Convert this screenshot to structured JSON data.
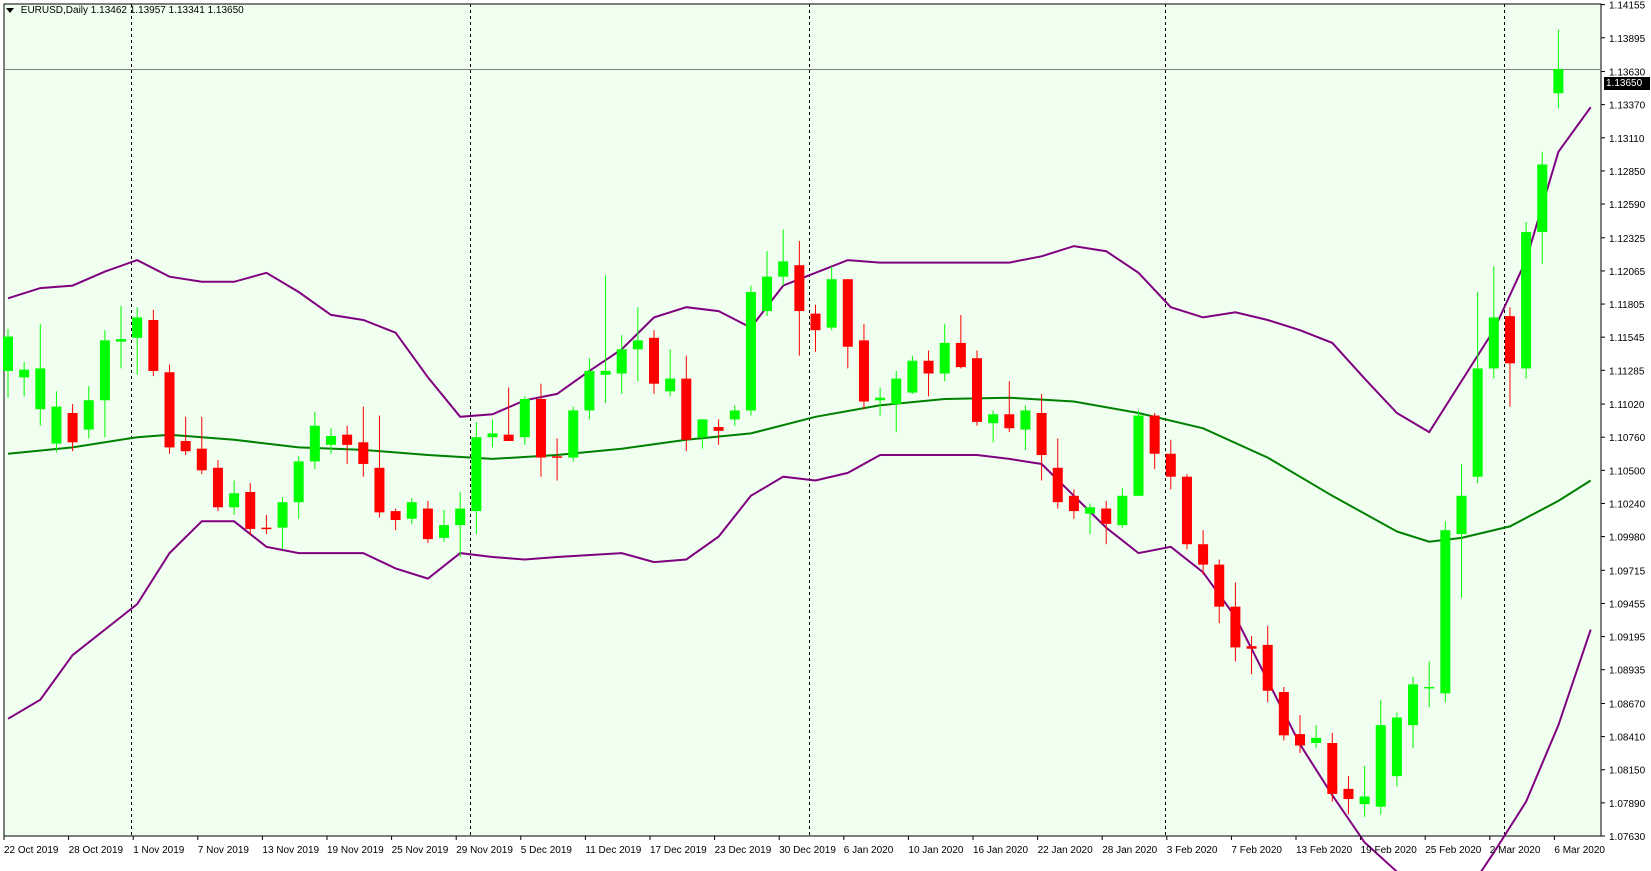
{
  "header": {
    "symbol": "EURUSD,Daily",
    "ohlc": "1.13462 1.13957 1.13341 1.13650"
  },
  "current_price": {
    "label": "1.13650",
    "value": 1.1365
  },
  "colors": {
    "background": "#f0fff0",
    "bull": "#00ff00",
    "bear": "#ff0000",
    "wick": "#00ff00",
    "middle_band": "#008000",
    "outer_band": "#800080",
    "grid": "#000000"
  },
  "chart_data": {
    "type": "candlestick",
    "ylim": [
      1.0763,
      1.1416
    ],
    "y_ticks": [
      "1.14155",
      "1.13895",
      "1.13630",
      "1.13370",
      "1.13110",
      "1.12850",
      "1.12590",
      "1.12325",
      "1.12065",
      "1.11805",
      "1.11545",
      "1.11285",
      "1.11020",
      "1.10760",
      "1.10500",
      "1.10240",
      "1.09980",
      "1.09715",
      "1.09455",
      "1.09195",
      "1.08935",
      "1.08670",
      "1.08410",
      "1.08150",
      "1.07890",
      "1.07630"
    ],
    "x_ticks": [
      {
        "label": "22 Oct 2019",
        "index": 0
      },
      {
        "label": "28 Oct 2019",
        "index": 4
      },
      {
        "label": "1 Nov 2019",
        "index": 8
      },
      {
        "label": "7 Nov 2019",
        "index": 12
      },
      {
        "label": "13 Nov 2019",
        "index": 16
      },
      {
        "label": "19 Nov 2019",
        "index": 20
      },
      {
        "label": "25 Nov 2019",
        "index": 24
      },
      {
        "label": "29 Nov 2019",
        "index": 28
      },
      {
        "label": "5 Dec 2019",
        "index": 32
      },
      {
        "label": "11 Dec 2019",
        "index": 36
      },
      {
        "label": "17 Dec 2019",
        "index": 40
      },
      {
        "label": "23 Dec 2019",
        "index": 44
      },
      {
        "label": "30 Dec 2019",
        "index": 48
      },
      {
        "label": "6 Jan 2020",
        "index": 52
      },
      {
        "label": "10 Jan 2020",
        "index": 56
      },
      {
        "label": "16 Jan 2020",
        "index": 60
      },
      {
        "label": "22 Jan 2020",
        "index": 64
      },
      {
        "label": "28 Jan 2020",
        "index": 68
      },
      {
        "label": "3 Feb 2020",
        "index": 72
      },
      {
        "label": "7 Feb 2020",
        "index": 76
      },
      {
        "label": "13 Feb 2020",
        "index": 80
      },
      {
        "label": "19 Feb 2020",
        "index": 84
      },
      {
        "label": "25 Feb 2020",
        "index": 88
      },
      {
        "label": "2 Mar 2020",
        "index": 92
      },
      {
        "label": "6 Mar 2020",
        "index": 96
      }
    ],
    "period_separators": [
      8,
      29,
      50,
      72,
      93
    ],
    "candles": [
      {
        "o": 1.1128,
        "h": 1.1161,
        "l": 1.1107,
        "c": 1.1155
      },
      {
        "o": 1.1123,
        "h": 1.1135,
        "l": 1.1108,
        "c": 1.1129
      },
      {
        "o": 1.1098,
        "h": 1.1165,
        "l": 1.1085,
        "c": 1.113
      },
      {
        "o": 1.1071,
        "h": 1.1112,
        "l": 1.1064,
        "c": 1.11
      },
      {
        "o": 1.1095,
        "h": 1.1102,
        "l": 1.1065,
        "c": 1.1072
      },
      {
        "o": 1.1082,
        "h": 1.1116,
        "l": 1.1075,
        "c": 1.1105
      },
      {
        "o": 1.1105,
        "h": 1.116,
        "l": 1.1076,
        "c": 1.1152
      },
      {
        "o": 1.1151,
        "h": 1.1179,
        "l": 1.113,
        "c": 1.1153
      },
      {
        "o": 1.1154,
        "h": 1.1178,
        "l": 1.1125,
        "c": 1.117
      },
      {
        "o": 1.1168,
        "h": 1.1176,
        "l": 1.1124,
        "c": 1.1128
      },
      {
        "o": 1.1127,
        "h": 1.1133,
        "l": 1.1063,
        "c": 1.1068
      },
      {
        "o": 1.1073,
        "h": 1.1092,
        "l": 1.1062,
        "c": 1.1065
      },
      {
        "o": 1.1067,
        "h": 1.1092,
        "l": 1.1047,
        "c": 1.105
      },
      {
        "o": 1.1052,
        "h": 1.1058,
        "l": 1.1018,
        "c": 1.1021
      },
      {
        "o": 1.1021,
        "h": 1.1042,
        "l": 1.1015,
        "c": 1.1032
      },
      {
        "o": 1.1033,
        "h": 1.104,
        "l": 1.0999,
        "c": 1.1004
      },
      {
        "o": 1.1005,
        "h": 1.1015,
        "l": 1.1,
        "c": 1.1004
      },
      {
        "o": 1.1005,
        "h": 1.1029,
        "l": 1.0988,
        "c": 1.1025
      },
      {
        "o": 1.1025,
        "h": 1.1061,
        "l": 1.1012,
        "c": 1.1057
      },
      {
        "o": 1.1057,
        "h": 1.1096,
        "l": 1.1051,
        "c": 1.1085
      },
      {
        "o": 1.107,
        "h": 1.1083,
        "l": 1.1063,
        "c": 1.1077
      },
      {
        "o": 1.1078,
        "h": 1.1085,
        "l": 1.1055,
        "c": 1.107
      },
      {
        "o": 1.1072,
        "h": 1.11,
        "l": 1.1045,
        "c": 1.1055
      },
      {
        "o": 1.1052,
        "h": 1.1093,
        "l": 1.1013,
        "c": 1.1017
      },
      {
        "o": 1.1018,
        "h": 1.102,
        "l": 1.1003,
        "c": 1.1011
      },
      {
        "o": 1.1012,
        "h": 1.1028,
        "l": 1.1008,
        "c": 1.1025
      },
      {
        "o": 1.102,
        "h": 1.1026,
        "l": 1.0993,
        "c": 1.0996
      },
      {
        "o": 1.0997,
        "h": 1.1019,
        "l": 1.0994,
        "c": 1.1007
      },
      {
        "o": 1.1007,
        "h": 1.1033,
        "l": 1.0982,
        "c": 1.102
      },
      {
        "o": 1.1018,
        "h": 1.1088,
        "l": 1.1,
        "c": 1.1076
      },
      {
        "o": 1.1076,
        "h": 1.109,
        "l": 1.1068,
        "c": 1.1079
      },
      {
        "o": 1.1078,
        "h": 1.1115,
        "l": 1.1075,
        "c": 1.1073
      },
      {
        "o": 1.1076,
        "h": 1.1108,
        "l": 1.107,
        "c": 1.1106
      },
      {
        "o": 1.1106,
        "h": 1.1118,
        "l": 1.1045,
        "c": 1.106
      },
      {
        "o": 1.1061,
        "h": 1.1075,
        "l": 1.1042,
        "c": 1.106
      },
      {
        "o": 1.106,
        "h": 1.11,
        "l": 1.1057,
        "c": 1.1097
      },
      {
        "o": 1.1097,
        "h": 1.1138,
        "l": 1.109,
        "c": 1.1128
      },
      {
        "o": 1.1125,
        "h": 1.1203,
        "l": 1.1103,
        "c": 1.1128
      },
      {
        "o": 1.1126,
        "h": 1.1156,
        "l": 1.111,
        "c": 1.1145
      },
      {
        "o": 1.1145,
        "h": 1.1178,
        "l": 1.112,
        "c": 1.1152
      },
      {
        "o": 1.1154,
        "h": 1.116,
        "l": 1.111,
        "c": 1.1118
      },
      {
        "o": 1.1112,
        "h": 1.1145,
        "l": 1.1108,
        "c": 1.1122
      },
      {
        "o": 1.1122,
        "h": 1.114,
        "l": 1.1065,
        "c": 1.1074
      },
      {
        "o": 1.1076,
        "h": 1.1089,
        "l": 1.1067,
        "c": 1.109
      },
      {
        "o": 1.1084,
        "h": 1.109,
        "l": 1.107,
        "c": 1.1081
      },
      {
        "o": 1.109,
        "h": 1.1101,
        "l": 1.1085,
        "c": 1.1097
      },
      {
        "o": 1.1097,
        "h": 1.1195,
        "l": 1.1093,
        "c": 1.119
      },
      {
        "o": 1.1175,
        "h": 1.1222,
        "l": 1.1171,
        "c": 1.1202
      },
      {
        "o": 1.1202,
        "h": 1.1239,
        "l": 1.1195,
        "c": 1.1214
      },
      {
        "o": 1.1211,
        "h": 1.123,
        "l": 1.114,
        "c": 1.1175
      },
      {
        "o": 1.1173,
        "h": 1.118,
        "l": 1.1143,
        "c": 1.116
      },
      {
        "o": 1.1162,
        "h": 1.121,
        "l": 1.116,
        "c": 1.12
      },
      {
        "o": 1.12,
        "h": 1.12,
        "l": 1.113,
        "c": 1.1147
      },
      {
        "o": 1.1152,
        "h": 1.1165,
        "l": 1.1098,
        "c": 1.1104
      },
      {
        "o": 1.1105,
        "h": 1.1115,
        "l": 1.1093,
        "c": 1.1107
      },
      {
        "o": 1.1102,
        "h": 1.1128,
        "l": 1.108,
        "c": 1.1122
      },
      {
        "o": 1.1111,
        "h": 1.114,
        "l": 1.111,
        "c": 1.1136
      },
      {
        "o": 1.1136,
        "h": 1.1144,
        "l": 1.1108,
        "c": 1.1126
      },
      {
        "o": 1.1126,
        "h": 1.1165,
        "l": 1.112,
        "c": 1.115
      },
      {
        "o": 1.115,
        "h": 1.1172,
        "l": 1.113,
        "c": 1.1131
      },
      {
        "o": 1.1138,
        "h": 1.1144,
        "l": 1.1085,
        "c": 1.1088
      },
      {
        "o": 1.1087,
        "h": 1.1097,
        "l": 1.1072,
        "c": 1.1094
      },
      {
        "o": 1.1094,
        "h": 1.112,
        "l": 1.108,
        "c": 1.1083
      },
      {
        "o": 1.1082,
        "h": 1.1101,
        "l": 1.1066,
        "c": 1.1097
      },
      {
        "o": 1.1095,
        "h": 1.111,
        "l": 1.1042,
        "c": 1.1062
      },
      {
        "o": 1.1052,
        "h": 1.1075,
        "l": 1.102,
        "c": 1.1025
      },
      {
        "o": 1.103,
        "h": 1.1035,
        "l": 1.1012,
        "c": 1.1018
      },
      {
        "o": 1.1016,
        "h": 1.1024,
        "l": 1.1,
        "c": 1.1021
      },
      {
        "o": 1.102,
        "h": 1.1026,
        "l": 1.0992,
        "c": 1.1008
      },
      {
        "o": 1.1007,
        "h": 1.1036,
        "l": 1.1005,
        "c": 1.103
      },
      {
        "o": 1.103,
        "h": 1.1097,
        "l": 1.103,
        "c": 1.1093
      },
      {
        "o": 1.1093,
        "h": 1.1095,
        "l": 1.1051,
        "c": 1.1063
      },
      {
        "o": 1.1063,
        "h": 1.1074,
        "l": 1.1035,
        "c": 1.1045
      },
      {
        "o": 1.1045,
        "h": 1.1047,
        "l": 1.0988,
        "c": 1.0992
      },
      {
        "o": 1.0992,
        "h": 1.1003,
        "l": 1.0968,
        "c": 1.0976
      },
      {
        "o": 1.0976,
        "h": 1.098,
        "l": 1.093,
        "c": 1.0943
      },
      {
        "o": 1.0943,
        "h": 1.0962,
        "l": 1.09,
        "c": 1.0911
      },
      {
        "o": 1.0912,
        "h": 1.092,
        "l": 1.089,
        "c": 1.091
      },
      {
        "o": 1.0913,
        "h": 1.0928,
        "l": 1.0868,
        "c": 1.0877
      },
      {
        "o": 1.0876,
        "h": 1.088,
        "l": 1.0838,
        "c": 1.0842
      },
      {
        "o": 1.0843,
        "h": 1.0858,
        "l": 1.0828,
        "c": 1.0834
      },
      {
        "o": 1.0836,
        "h": 1.085,
        "l": 1.0832,
        "c": 1.084
      },
      {
        "o": 1.0836,
        "h": 1.0844,
        "l": 1.079,
        "c": 1.0796
      },
      {
        "o": 1.08,
        "h": 1.081,
        "l": 1.078,
        "c": 1.0792
      },
      {
        "o": 1.0788,
        "h": 1.0818,
        "l": 1.0778,
        "c": 1.0794
      },
      {
        "o": 1.0786,
        "h": 1.087,
        "l": 1.078,
        "c": 1.085
      },
      {
        "o": 1.081,
        "h": 1.086,
        "l": 1.0802,
        "c": 1.0856
      },
      {
        "o": 1.085,
        "h": 1.0888,
        "l": 1.0832,
        "c": 1.0882
      },
      {
        "o": 1.088,
        "h": 1.09,
        "l": 1.0864,
        "c": 1.088
      },
      {
        "o": 1.0875,
        "h": 1.101,
        "l": 1.0868,
        "c": 1.1003
      },
      {
        "o": 1.1,
        "h": 1.1055,
        "l": 1.095,
        "c": 1.103
      },
      {
        "o": 1.1045,
        "h": 1.119,
        "l": 1.104,
        "c": 1.113
      },
      {
        "o": 1.113,
        "h": 1.121,
        "l": 1.1122,
        "c": 1.117
      },
      {
        "o": 1.1171,
        "h": 1.1178,
        "l": 1.11,
        "c": 1.1134
      },
      {
        "o": 1.113,
        "h": 1.1245,
        "l": 1.1122,
        "c": 1.1237
      },
      {
        "o": 1.1237,
        "h": 1.13,
        "l": 1.1212,
        "c": 1.129
      },
      {
        "o": 1.1346,
        "h": 1.1396,
        "l": 1.1334,
        "c": 1.1365
      }
    ],
    "middle_band": [
      [
        0,
        1.1063
      ],
      [
        4,
        1.1068
      ],
      [
        8,
        1.1076
      ],
      [
        10,
        1.1078
      ],
      [
        14,
        1.1074
      ],
      [
        18,
        1.1068
      ],
      [
        22,
        1.1066
      ],
      [
        26,
        1.1062
      ],
      [
        30,
        1.1059
      ],
      [
        34,
        1.1062
      ],
      [
        38,
        1.1067
      ],
      [
        42,
        1.1074
      ],
      [
        46,
        1.1079
      ],
      [
        50,
        1.1092
      ],
      [
        54,
        1.1101
      ],
      [
        58,
        1.1106
      ],
      [
        62,
        1.1107
      ],
      [
        66,
        1.1104
      ],
      [
        70,
        1.1095
      ],
      [
        74,
        1.1083
      ],
      [
        78,
        1.106
      ],
      [
        82,
        1.103
      ],
      [
        86,
        1.1002
      ],
      [
        88,
        1.0994
      ],
      [
        90,
        1.0997
      ],
      [
        93,
        1.1006
      ],
      [
        96,
        1.1026
      ],
      [
        98,
        1.1042
      ]
    ],
    "upper_band": [
      [
        0,
        1.1185
      ],
      [
        2,
        1.1193
      ],
      [
        4,
        1.1195
      ],
      [
        6,
        1.1206
      ],
      [
        8,
        1.1215
      ],
      [
        10,
        1.1202
      ],
      [
        12,
        1.1198
      ],
      [
        14,
        1.1198
      ],
      [
        16,
        1.1205
      ],
      [
        18,
        1.119
      ],
      [
        20,
        1.1172
      ],
      [
        22,
        1.1168
      ],
      [
        24,
        1.1158
      ],
      [
        26,
        1.1123
      ],
      [
        28,
        1.1092
      ],
      [
        30,
        1.1094
      ],
      [
        32,
        1.1105
      ],
      [
        34,
        1.111
      ],
      [
        36,
        1.1128
      ],
      [
        38,
        1.1145
      ],
      [
        40,
        1.117
      ],
      [
        42,
        1.1178
      ],
      [
        44,
        1.1175
      ],
      [
        46,
        1.1162
      ],
      [
        48,
        1.1195
      ],
      [
        50,
        1.1205
      ],
      [
        52,
        1.1215
      ],
      [
        54,
        1.1213
      ],
      [
        58,
        1.1213
      ],
      [
        62,
        1.1213
      ],
      [
        64,
        1.1218
      ],
      [
        66,
        1.1226
      ],
      [
        68,
        1.1222
      ],
      [
        70,
        1.1205
      ],
      [
        72,
        1.1178
      ],
      [
        74,
        1.117
      ],
      [
        76,
        1.1174
      ],
      [
        78,
        1.1168
      ],
      [
        80,
        1.116
      ],
      [
        82,
        1.115
      ],
      [
        84,
        1.1122
      ],
      [
        86,
        1.1095
      ],
      [
        88,
        1.108
      ],
      [
        90,
        1.112
      ],
      [
        92,
        1.116
      ],
      [
        94,
        1.1215
      ],
      [
        96,
        1.13
      ],
      [
        98,
        1.1335
      ]
    ],
    "lower_band": [
      [
        0,
        1.0855
      ],
      [
        2,
        1.087
      ],
      [
        4,
        1.0905
      ],
      [
        6,
        1.0925
      ],
      [
        8,
        1.0945
      ],
      [
        10,
        1.0985
      ],
      [
        12,
        1.101
      ],
      [
        14,
        1.101
      ],
      [
        16,
        1.099
      ],
      [
        18,
        1.0985
      ],
      [
        22,
        1.0985
      ],
      [
        24,
        1.0973
      ],
      [
        26,
        1.0965
      ],
      [
        28,
        1.0985
      ],
      [
        30,
        1.0982
      ],
      [
        32,
        1.098
      ],
      [
        34,
        1.0982
      ],
      [
        38,
        1.0985
      ],
      [
        40,
        1.0978
      ],
      [
        42,
        1.098
      ],
      [
        44,
        1.0998
      ],
      [
        46,
        1.103
      ],
      [
        48,
        1.1045
      ],
      [
        50,
        1.1042
      ],
      [
        52,
        1.1048
      ],
      [
        54,
        1.1062
      ],
      [
        56,
        1.1062
      ],
      [
        60,
        1.1062
      ],
      [
        62,
        1.1059
      ],
      [
        64,
        1.1055
      ],
      [
        66,
        1.103
      ],
      [
        68,
        1.1005
      ],
      [
        70,
        1.0985
      ],
      [
        72,
        1.099
      ],
      [
        74,
        1.097
      ],
      [
        76,
        1.0935
      ],
      [
        78,
        1.0885
      ],
      [
        80,
        1.0835
      ],
      [
        82,
        1.0795
      ],
      [
        84,
        1.0758
      ],
      [
        86,
        1.0735
      ],
      [
        88,
        1.0723
      ],
      [
        90,
        1.0712
      ],
      [
        92,
        1.075
      ],
      [
        94,
        1.079
      ],
      [
        96,
        1.085
      ],
      [
        98,
        1.0925
      ]
    ]
  }
}
